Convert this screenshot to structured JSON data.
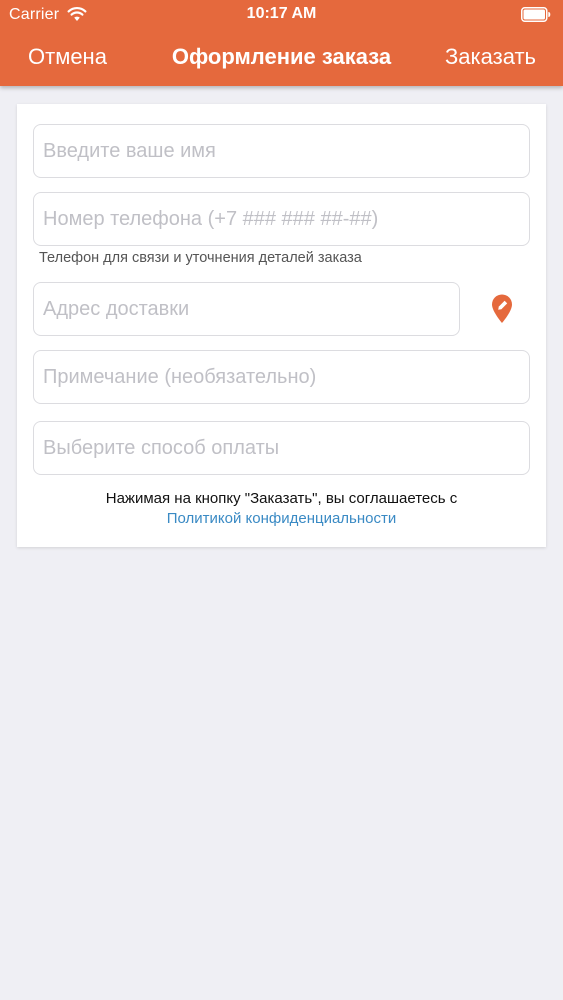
{
  "status_bar": {
    "carrier": "Carrier",
    "time": "10:17 AM"
  },
  "nav": {
    "cancel_label": "Отмена",
    "title": "Оформление заказа",
    "order_label": "Заказать"
  },
  "form": {
    "name_placeholder": "Введите ваше имя",
    "phone_placeholder": "Номер телефона (+7 ### ### ##-##)",
    "phone_hint": "Телефон для связи и уточнения деталей заказа",
    "address_placeholder": "Адрес доставки",
    "note_placeholder": "Примечание (необязательно)",
    "payment_placeholder": "Выберите способ оплаты",
    "agreement_text": "Нажимая на кнопку \"Заказать\", вы соглашаетесь с",
    "privacy_link": "Политикой конфиденциальности"
  },
  "icons": {
    "wifi": "wifi-icon",
    "battery": "battery-icon",
    "location": "map-pin-edit-icon"
  },
  "colors": {
    "accent": "#e5693d",
    "link": "#3a8ac4",
    "background": "#efeff4"
  }
}
